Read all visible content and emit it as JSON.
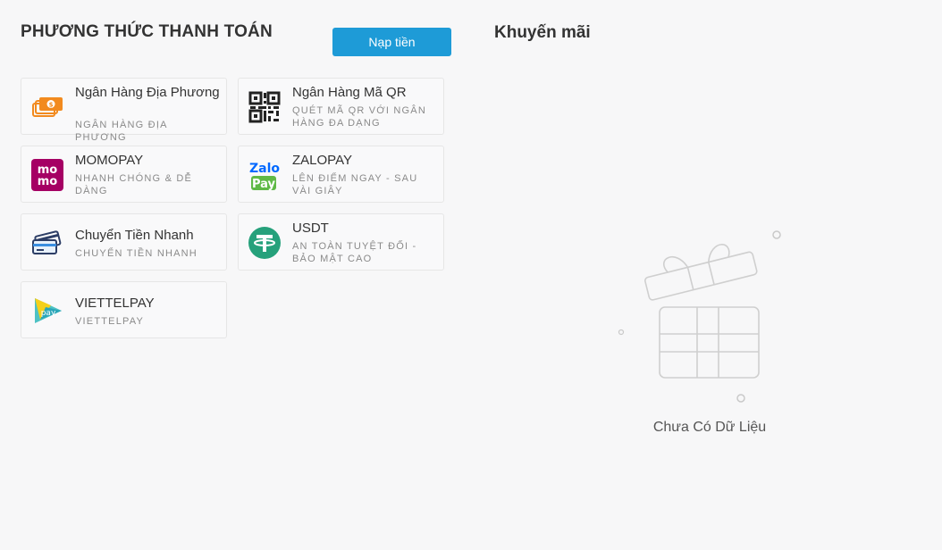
{
  "payment": {
    "title": "PHƯƠNG THỨC THANH TOÁN",
    "deposit_label": "Nạp tiền",
    "methods": [
      {
        "name": "Ngân Hàng Địa Phương",
        "desc": "NGÂN HÀNG ĐỊA PHƯƠNG",
        "icon": "local-bank-icon"
      },
      {
        "name": "Ngân Hàng Mã QR",
        "desc": "QUÉT MÃ QR VỚI NGÂN HÀNG ĐA DẠNG",
        "icon": "qr-code-icon"
      },
      {
        "name": "MOMOPAY",
        "desc": "NHANH CHÓNG & DỄ DÀNG",
        "icon": "momo-icon"
      },
      {
        "name": "ZALOPAY",
        "desc": "LÊN ĐIỂM NGAY - SAU VÀI GIÂY",
        "icon": "zalopay-icon"
      },
      {
        "name": "Chuyển Tiền Nhanh",
        "desc": "CHUYỂN TIỀN NHANH",
        "icon": "cards-icon"
      },
      {
        "name": "USDT",
        "desc": "AN TOÀN TUYỆT ĐỐI - BẢO MẬT CAO",
        "icon": "tether-icon"
      },
      {
        "name": "VIETTELPAY",
        "desc": "VIETTELPAY",
        "icon": "viettelpay-icon"
      }
    ]
  },
  "promo": {
    "title": "Khuyến mãi",
    "empty_text": "Chưa Có Dữ Liệu",
    "empty_icon": "gift-box-icon"
  },
  "icon_text": {
    "momo_top": "mo",
    "momo_bottom": "mo",
    "zalo_top": "Zalo",
    "zalo_bottom": "Pay",
    "viettel": "pay"
  },
  "colors": {
    "accent": "#1e9bd7",
    "momo": "#a50064",
    "zalo": "#0068ff",
    "zalo_green": "#5fb946",
    "tether": "#26a17b",
    "bank_orange": "#f28a1e"
  }
}
